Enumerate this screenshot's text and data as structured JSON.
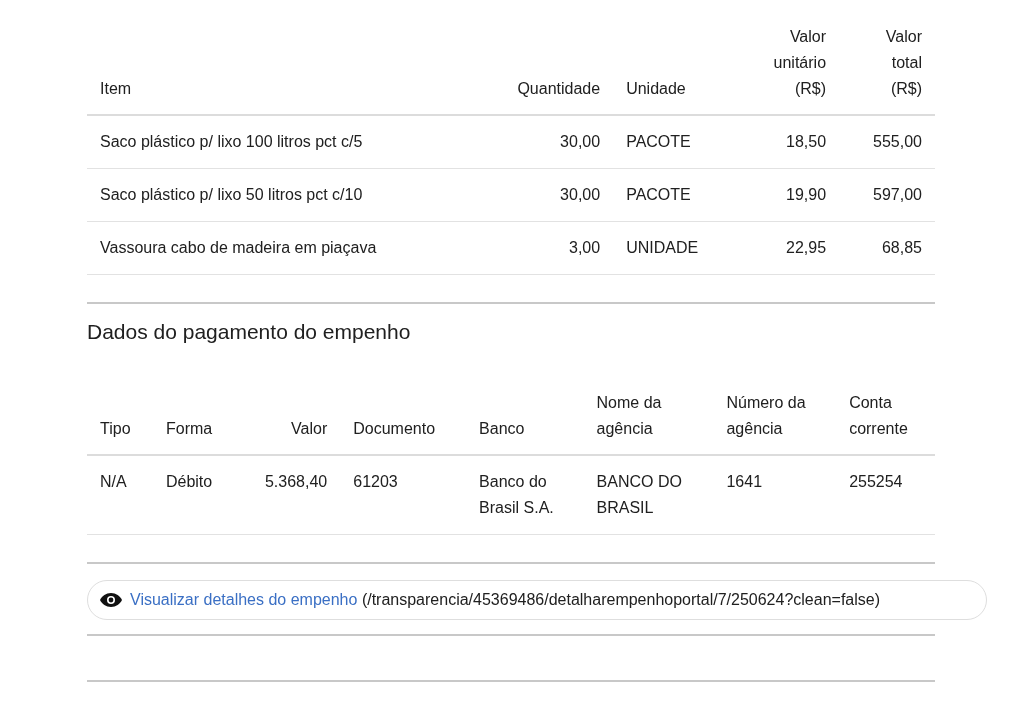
{
  "items_table": {
    "columns": [
      {
        "label": "Item",
        "kind": "text"
      },
      {
        "label": "Quantidade",
        "kind": "numeric"
      },
      {
        "label": "Unidade",
        "kind": "text"
      },
      {
        "label": "Valor\nunitário\n(R$)",
        "kind": "numeric"
      },
      {
        "label": "Valor\ntotal\n(R$)",
        "kind": "numeric"
      }
    ],
    "rows": [
      [
        "Saco plástico p/ lixo 100 litros pct c/5",
        "30,00",
        "PACOTE",
        "18,50",
        "555,00"
      ],
      [
        "Saco plástico p/ lixo 50 litros pct c/10",
        "30,00",
        "PACOTE",
        "19,90",
        "597,00"
      ],
      [
        "Vassoura cabo de madeira em piaçava",
        "3,00",
        "UNIDADE",
        "22,95",
        "68,85"
      ]
    ]
  },
  "payment_section": {
    "title": "Dados do pagamento do empenho",
    "columns": [
      {
        "label": "Tipo",
        "kind": "text"
      },
      {
        "label": "Forma",
        "kind": "text"
      },
      {
        "label": "Valor",
        "kind": "numeric"
      },
      {
        "label": "Documento",
        "kind": "text"
      },
      {
        "label": "Banco",
        "kind": "text"
      },
      {
        "label": "Nome da\nagência",
        "kind": "text"
      },
      {
        "label": "Número da\nagência",
        "kind": "text"
      },
      {
        "label": "Conta\ncorrente",
        "kind": "text"
      }
    ],
    "rows": [
      [
        "N/A",
        "Débito",
        "5.368,40",
        "61203",
        "Banco do\nBrasil S.A.",
        "BANCO DO\nBRASIL",
        "1641",
        "255254"
      ]
    ]
  },
  "details_link": {
    "label": "Visualizar detalhes do empenho",
    "url_text": "(/transparencia/45369486/detalharempenhoportal/7/250624?clean=false)"
  }
}
